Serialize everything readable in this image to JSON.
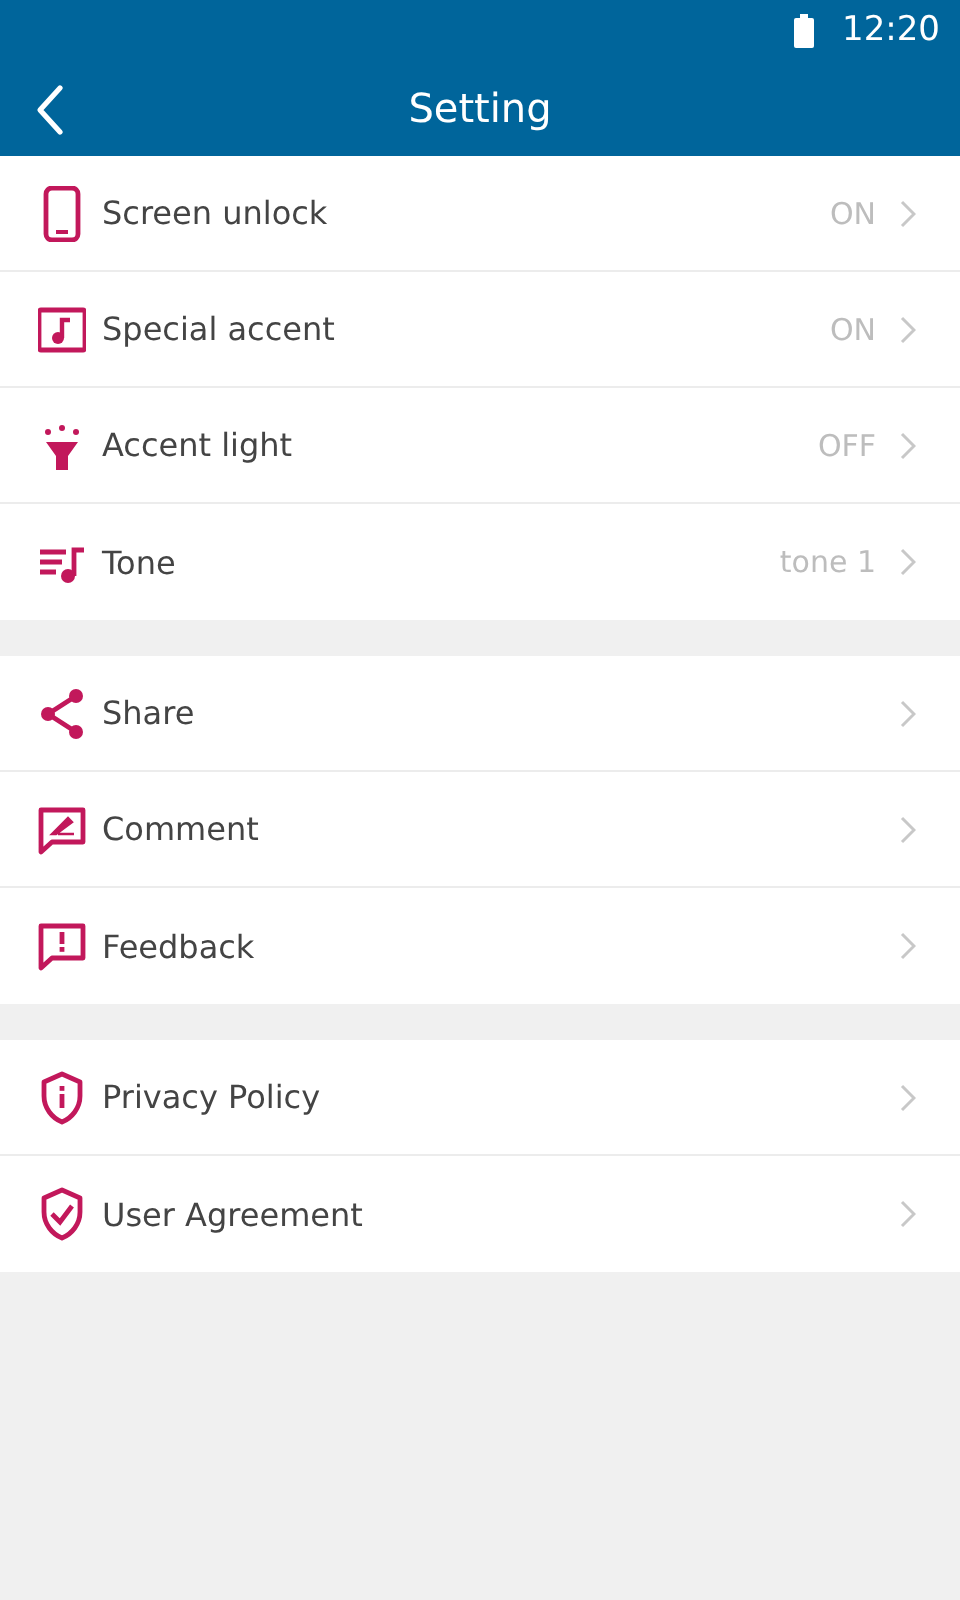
{
  "status_bar": {
    "time": "12:20"
  },
  "header": {
    "title": "Setting"
  },
  "groups": [
    {
      "items": [
        {
          "kind": "phone",
          "label": "Screen unlock",
          "value": "ON"
        },
        {
          "kind": "music-box",
          "label": "Special accent",
          "value": "ON"
        },
        {
          "kind": "lamp",
          "label": "Accent light",
          "value": "OFF"
        },
        {
          "kind": "playlist",
          "label": "Tone",
          "value": "tone 1"
        }
      ]
    },
    {
      "items": [
        {
          "kind": "share",
          "label": "Share"
        },
        {
          "kind": "comment",
          "label": "Comment"
        },
        {
          "kind": "feedback",
          "label": "Feedback"
        }
      ]
    },
    {
      "items": [
        {
          "kind": "shield-info",
          "label": "Privacy Policy"
        },
        {
          "kind": "shield-check",
          "label": "User Agreement"
        }
      ]
    }
  ]
}
